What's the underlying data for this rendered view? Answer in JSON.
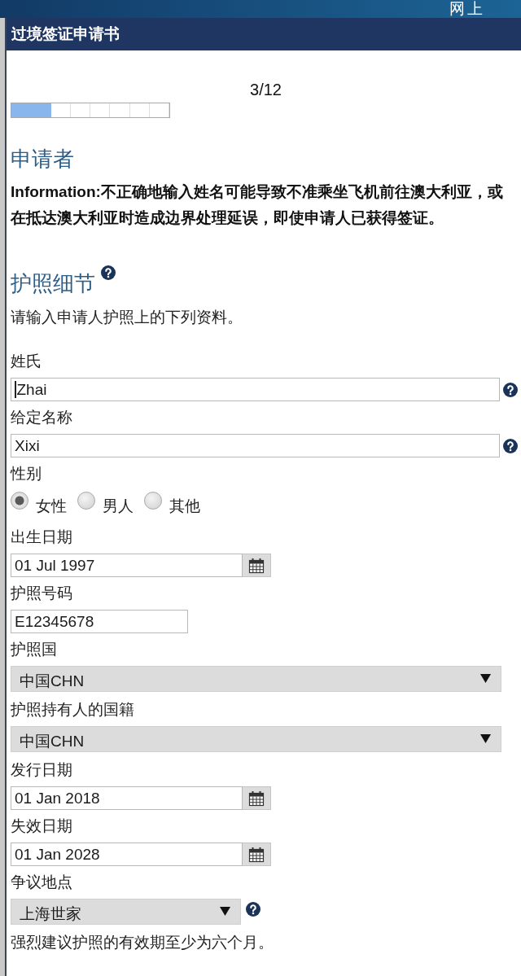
{
  "top_bar": {
    "title": "网上"
  },
  "form_header": {
    "title": "过境签证申请书"
  },
  "progress": {
    "label": "3/12",
    "level": 0.25
  },
  "applicant": {
    "title": "申请者",
    "information": "Information:不正确地输入姓名可能导致不准乘坐飞机前往澳大利亚，或在抵达澳大利亚时造成边界处理延误，即使申请人已获得签证。"
  },
  "passport": {
    "title": "护照细节",
    "help": true,
    "intro": "请输入申请人护照上的下列资料。",
    "fields": [
      {
        "kind": "text",
        "label": "姓氏",
        "value": "Zhai",
        "focused": true,
        "help": true
      },
      {
        "kind": "text",
        "label": "给定名称",
        "value": "Xixi",
        "focused": false,
        "help": true
      },
      {
        "kind": "radio",
        "label": "性别",
        "help": false,
        "options": [
          {
            "label": "女性",
            "selected": true
          },
          {
            "label": "男人",
            "selected": false
          },
          {
            "label": "其他",
            "selected": false
          }
        ]
      },
      {
        "kind": "date",
        "label": "出生日期",
        "value": "01 Jul 1997",
        "focused": false,
        "help": false
      },
      {
        "kind": "short_text",
        "label": "护照号码",
        "value": "E12345678",
        "focused": false,
        "help": false
      },
      {
        "kind": "select",
        "label": "护照国",
        "value": "中国CHN",
        "focused": false,
        "help": false
      },
      {
        "kind": "select",
        "label": "护照持有人的国籍",
        "value": "中国CHN",
        "focused": false,
        "help": false
      },
      {
        "kind": "date",
        "label": "发行日期",
        "value": "01 Jan 2018",
        "focused": false,
        "help": false
      },
      {
        "kind": "date",
        "label": "失效日期",
        "value": "01 Jan 2028",
        "focused": false,
        "help": false
      },
      {
        "kind": "short_select",
        "label": "争议地点",
        "value": "上海世家",
        "focused": false,
        "help": true
      }
    ],
    "note": "强烈建议护照的有效期至少为六个月。"
  }
}
